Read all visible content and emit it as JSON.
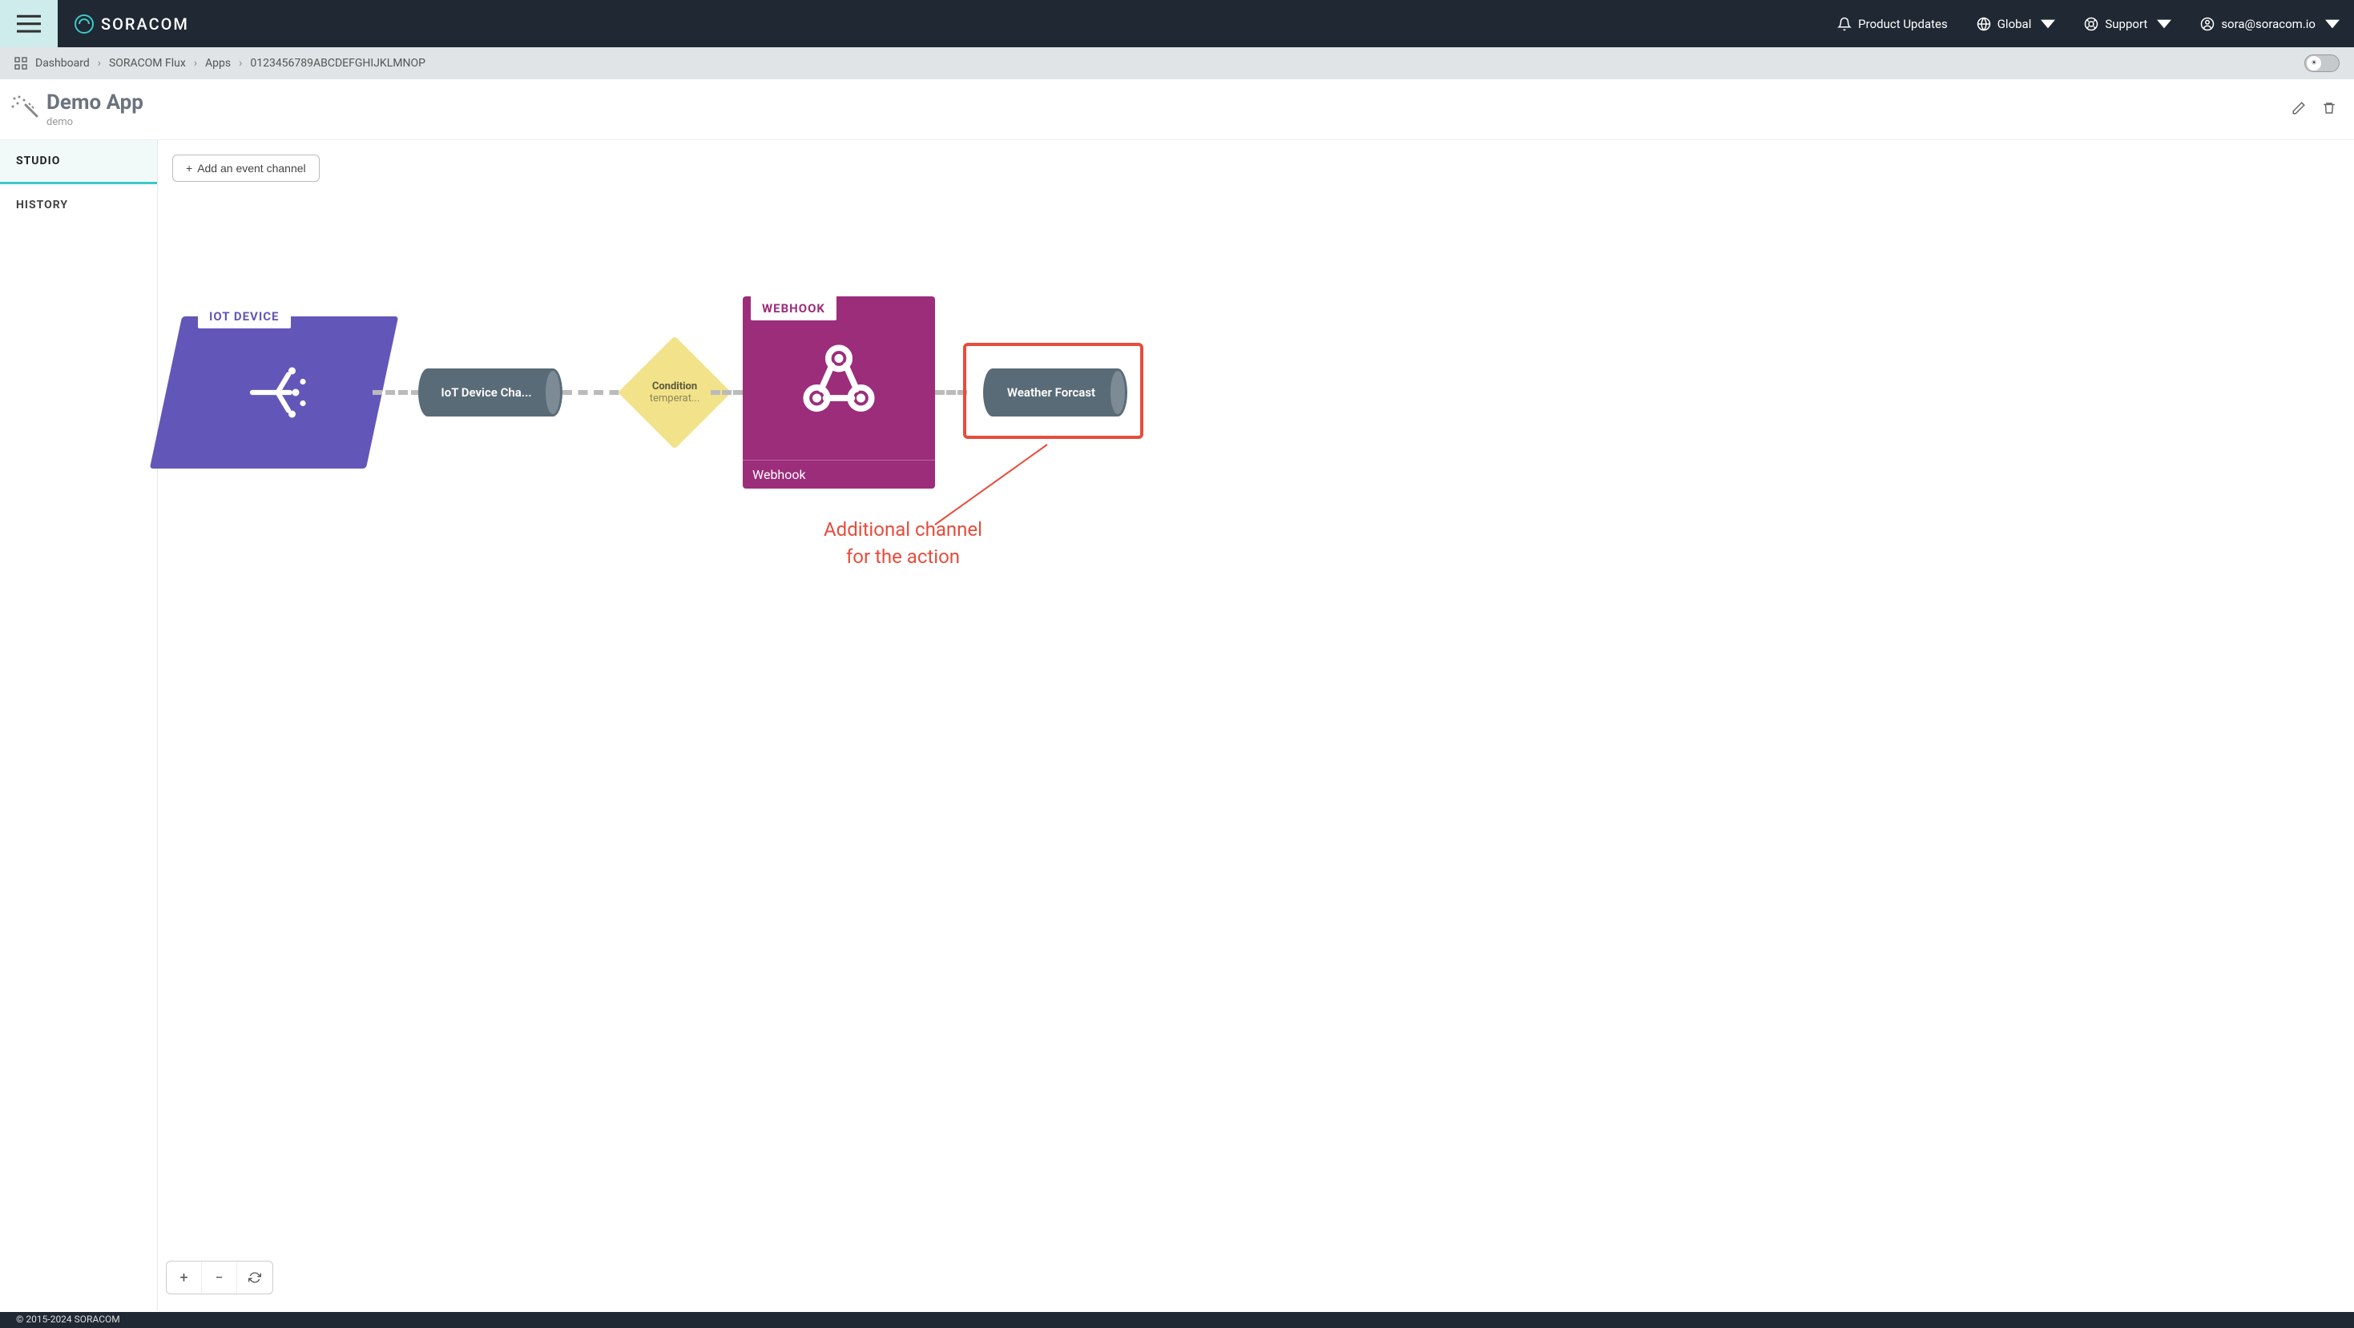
{
  "brand": "SORACOM",
  "nav": {
    "product_updates": "Product Updates",
    "global": "Global",
    "support": "Support",
    "user_email": "sora@soracom.io"
  },
  "breadcrumb": {
    "dashboard": "Dashboard",
    "flux": "SORACOM Flux",
    "apps": "Apps",
    "app_id": "0123456789ABCDEFGHIJKLMNOP"
  },
  "page": {
    "title": "Demo App",
    "subtitle": "demo"
  },
  "sidebar": {
    "studio": "STUDIO",
    "history": "HISTORY"
  },
  "toolbar": {
    "add_channel": "Add an event channel"
  },
  "flow": {
    "iot_label": "IOT DEVICE",
    "channel1": "IoT Device Cha...",
    "condition_title": "Condition",
    "condition_sub": "temperat...",
    "webhook_label": "WEBHOOK",
    "webhook_footer": "Webhook",
    "channel2": "Weather Forcast"
  },
  "annotation": {
    "text1": "Additional channel",
    "text2": "for the action"
  },
  "zoom": {
    "plus": "+",
    "minus": "−"
  },
  "footer": "© 2015-2024 SORACOM"
}
